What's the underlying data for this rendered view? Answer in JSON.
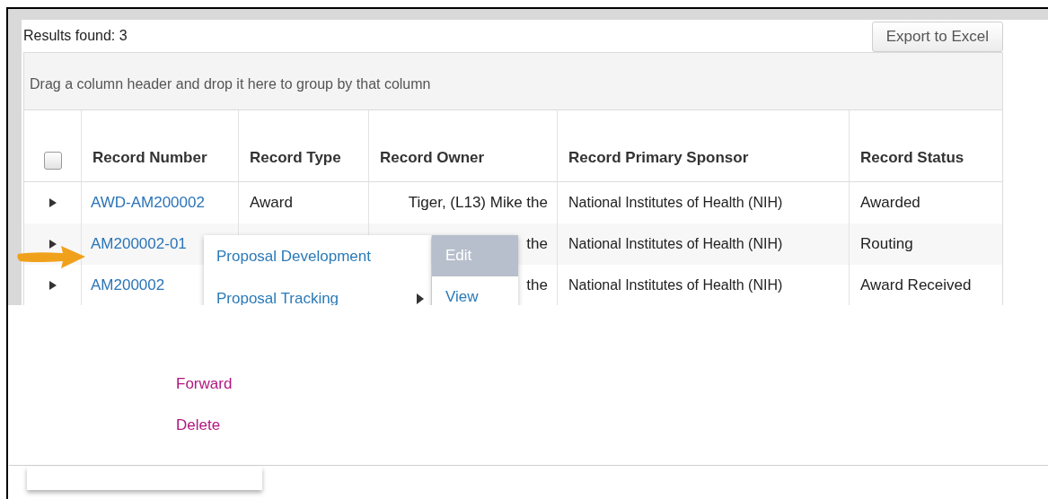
{
  "results_label": "Results found: 3",
  "export_button": "Export to Excel",
  "group_hint": "Drag a column header and drop it here to group by that column",
  "select_all": {
    "checked": false
  },
  "columns": [
    "Record Number",
    "Record Type",
    "Record Owner",
    "Record Primary Sponsor",
    "Record Status"
  ],
  "rows": [
    {
      "number": "AWD-AM200002",
      "type": "Award",
      "owner": "Tiger, (L13) Mike the",
      "sponsor": "National Institutes of Health (NIH)",
      "status": "Awarded",
      "pointed": false
    },
    {
      "number": "AM200002-01",
      "owner": "the",
      "sponsor": "National Institutes of Health (NIH)",
      "status": "Routing",
      "pointed": true
    },
    {
      "number": "AM200002",
      "owner": "the",
      "sponsor": "National Institutes of Health (NIH)",
      "status": "Award Received",
      "pointed": false
    }
  ],
  "context_menu": {
    "items": [
      {
        "label": "Proposal Development",
        "submenu": false
      },
      {
        "label": "Proposal Tracking",
        "submenu": true
      }
    ],
    "submenu": [
      {
        "label": "Edit",
        "selected": true
      },
      {
        "label": "View",
        "selected": false
      }
    ]
  },
  "actions": [
    "Forward",
    "Delete"
  ]
}
